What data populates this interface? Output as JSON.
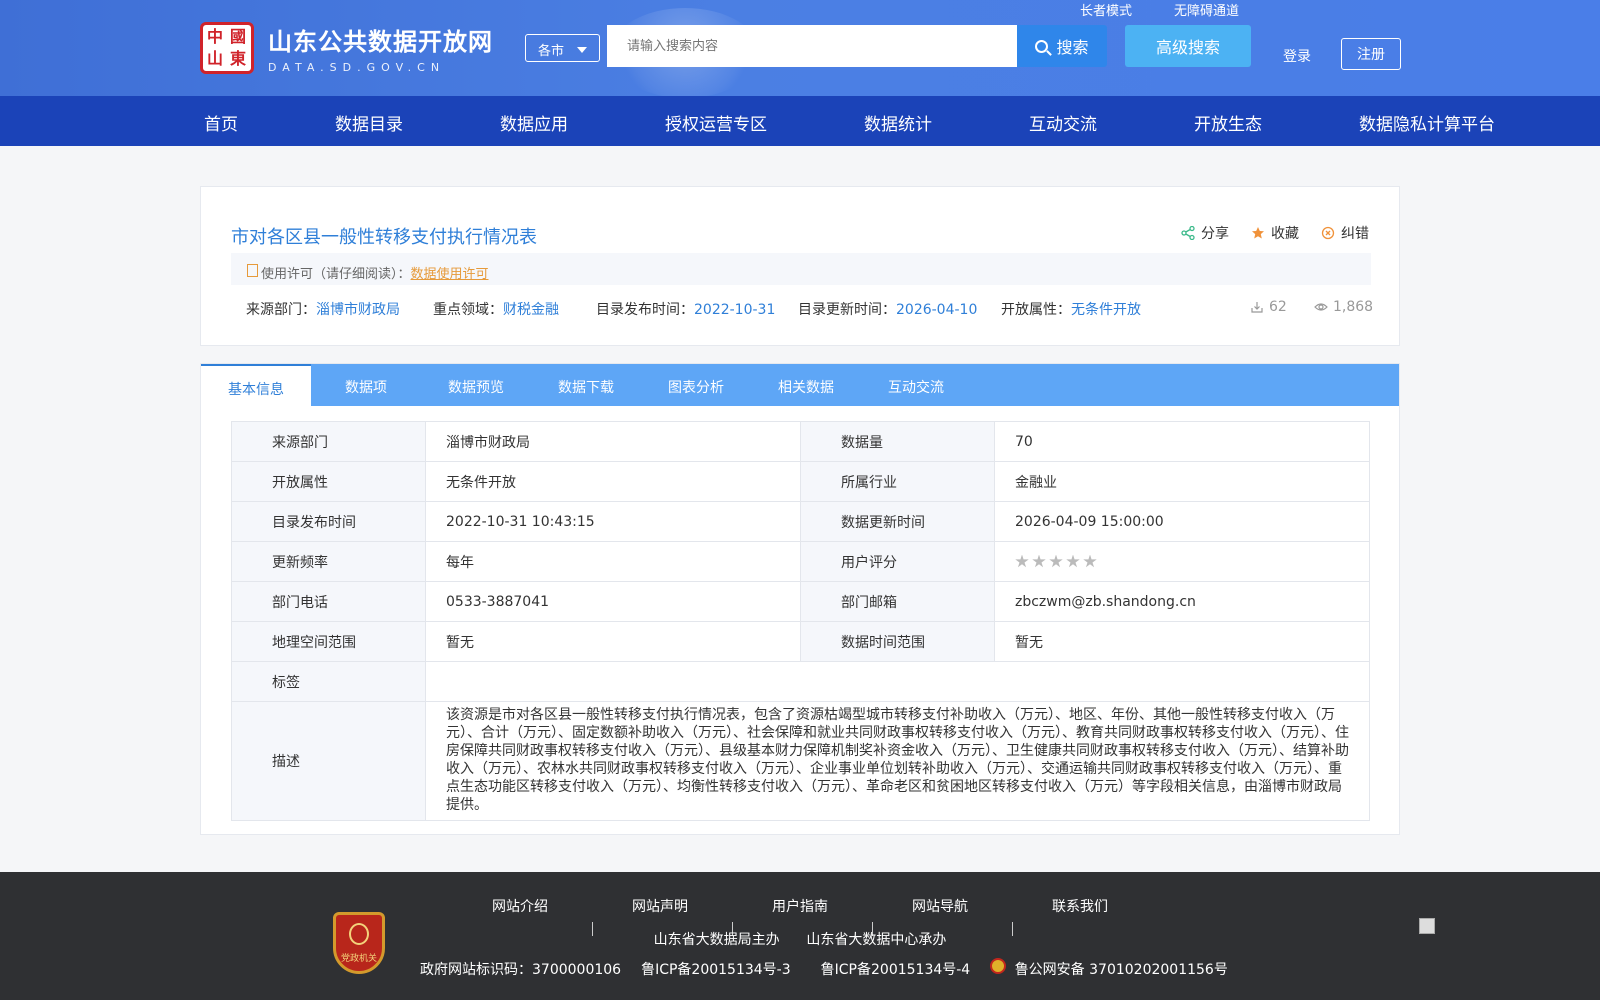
{
  "header": {
    "site_name_cn": "山东公共数据开放网",
    "site_name_en": "DATA.SD.GOV.CN",
    "elder_mode": "长者模式",
    "accessibility": "无障碍通道",
    "region_select": "各市",
    "search_placeholder": "请输入搜索内容",
    "search_button": "搜索",
    "advanced_search": "高级搜索",
    "login": "登录",
    "register": "注册"
  },
  "nav": [
    "首页",
    "数据目录",
    "数据应用",
    "授权运营专区",
    "数据统计",
    "互动交流",
    "开放生态",
    "数据隐私计算平台"
  ],
  "dataset": {
    "title": "市对各区县一般性转移支付执行情况表",
    "actions": {
      "share": "分享",
      "favorite": "收藏",
      "report": "纠错"
    },
    "license_label": "使用许可（请仔细阅读）：",
    "license_link": "数据使用许可",
    "meta": {
      "source_label": "来源部门：",
      "source": "淄博市财政局",
      "field_label": "重点领域：",
      "field": "财税金融",
      "publish_label": "目录发布时间：",
      "publish": "2022-10-31",
      "update_label": "目录更新时间：",
      "update": "2026-04-10",
      "open_label": "开放属性：",
      "open": "无条件开放",
      "downloads": "62",
      "views": "1,868"
    }
  },
  "tabs": [
    "基本信息",
    "数据项",
    "数据预览",
    "数据下载",
    "图表分析",
    "相关数据",
    "互动交流"
  ],
  "info": {
    "rows": [
      [
        "来源部门",
        "淄博市财政局",
        "数据量",
        "70"
      ],
      [
        "开放属性",
        "无条件开放",
        "所属行业",
        "金融业"
      ],
      [
        "目录发布时间",
        "2022-10-31 10:43:15",
        "数据更新时间",
        "2026-04-09 15:00:00"
      ],
      [
        "更新频率",
        "每年",
        "用户评分",
        ""
      ],
      [
        "部门电话",
        "0533-3887041",
        "部门邮箱",
        "zbczwm@zb.shandong.cn"
      ],
      [
        "地理空间范围",
        "暂无",
        "数据时间范围",
        "暂无"
      ]
    ],
    "rating_stars": 0,
    "tags_label": "标签",
    "tags_value": "",
    "desc_label": "描述",
    "desc_value": "该资源是市对各区县一般性转移支付执行情况表，包含了资源枯竭型城市转移支付补助收入（万元）、地区、年份、其他一般性转移支付收入（万元）、合计（万元）、固定数额补助收入（万元）、社会保障和就业共同财政事权转移支付收入（万元）、教育共同财政事权转移支付收入（万元）、住房保障共同财政事权转移支付收入（万元）、县级基本财力保障机制奖补资金收入（万元）、卫生健康共同财政事权转移支付收入（万元）、结算补助收入（万元）、农林水共同财政事权转移支付收入（万元）、企业事业单位划转补助收入（万元）、交通运输共同财政事权转移支付收入（万元）、重点生态功能区转移支付收入（万元）、均衡性转移支付收入（万元）、革命老区和贫困地区转移支付收入（万元）等字段相关信息，由淄博市财政局提供。"
  },
  "footer": {
    "links": [
      "网站介绍",
      "网站声明",
      "用户指南",
      "网站导航",
      "联系我们"
    ],
    "host": "山东省大数据局主办",
    "undertaker": "山东省大数据中心承办",
    "gov_id": "政府网站标识码：3700000106",
    "icp3": "鲁ICP备20015134号-3",
    "icp4": "鲁ICP备20015134号-4",
    "police": "鲁公网安备 37010202001156号",
    "badge_text": "党政机关"
  }
}
